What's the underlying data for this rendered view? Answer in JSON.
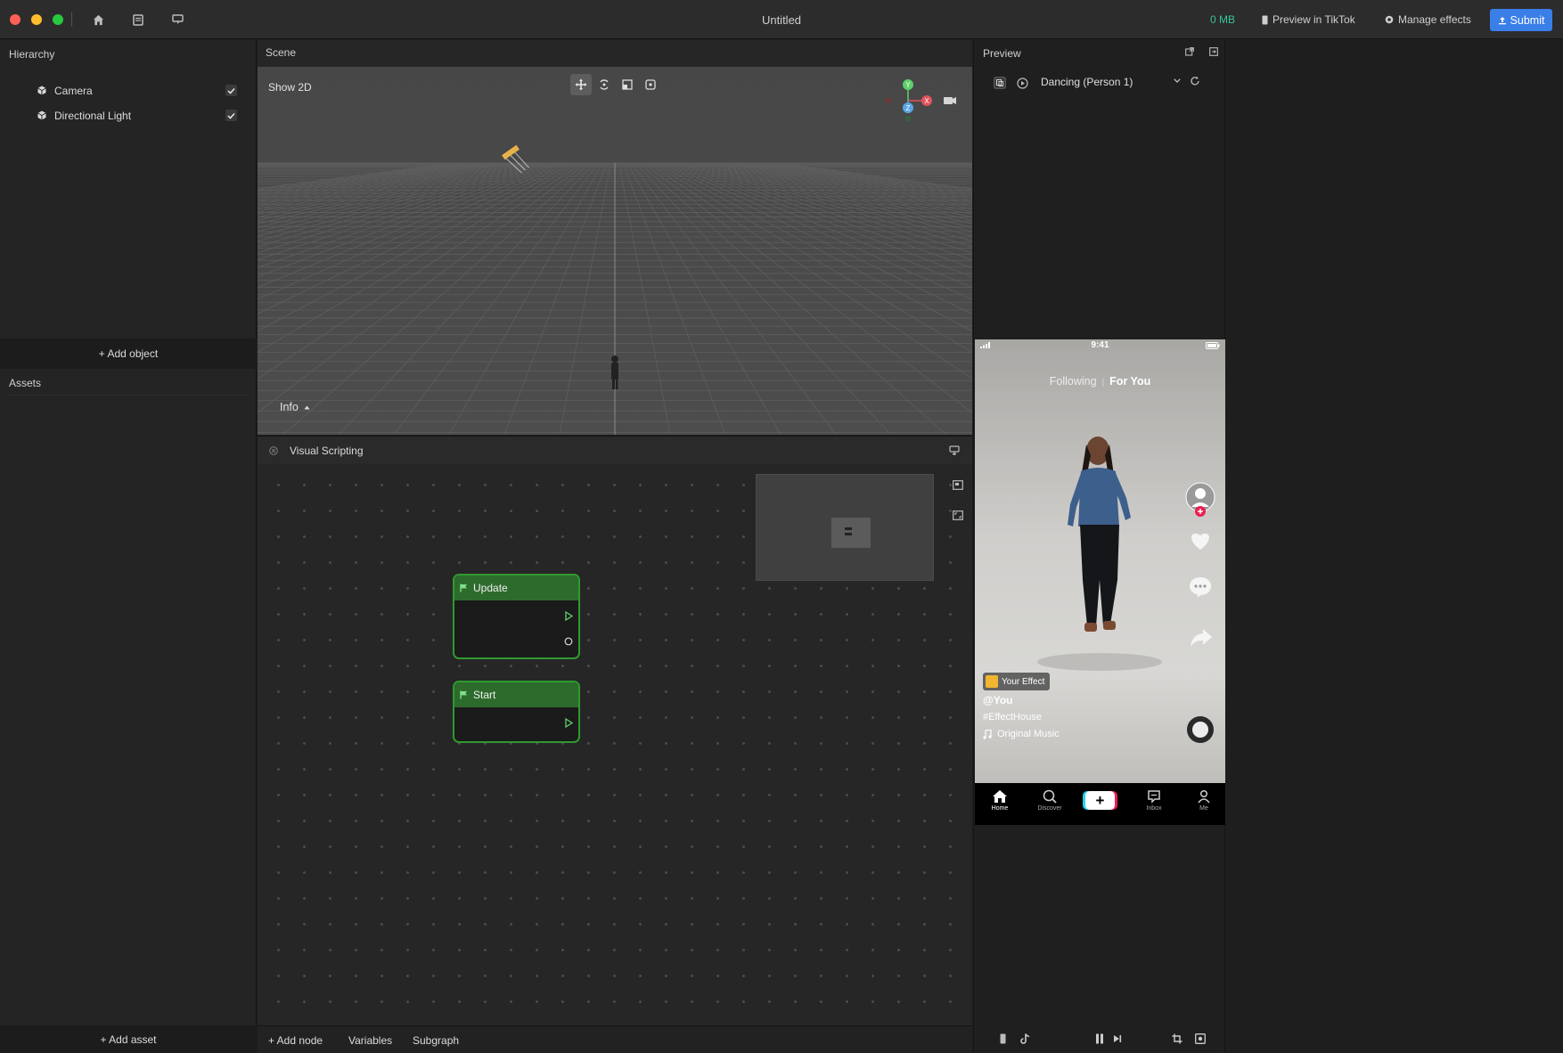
{
  "window": {
    "title": "Untitled",
    "memory": "0 MB",
    "preview_tiktok": "Preview in TikTok",
    "manage_effects": "Manage effects",
    "submit": "Submit"
  },
  "hierarchy": {
    "title": "Hierarchy",
    "items": [
      {
        "label": "Camera",
        "checked": true
      },
      {
        "label": "Directional Light",
        "checked": true
      }
    ],
    "add_object": "+ Add object"
  },
  "assets": {
    "title": "Assets",
    "add_asset": "+ Add asset"
  },
  "scene": {
    "title": "Scene",
    "show2d": "Show 2D",
    "info": "Info",
    "tools": [
      "move-icon",
      "rotate-icon",
      "scale-icon",
      "rect-icon"
    ],
    "axis_labels": {
      "y": "Y",
      "z": "Z",
      "x": "X"
    }
  },
  "visual_scripting": {
    "title": "Visual Scripting",
    "nodes": [
      {
        "title": "Update"
      },
      {
        "title": "Start"
      }
    ],
    "footer": {
      "add_node": "+ Add node",
      "variables": "Variables",
      "subgraph": "Subgraph"
    }
  },
  "preview": {
    "title": "Preview",
    "selected_video": "Dancing (Person 1)",
    "phone": {
      "time": "9:41",
      "tab_following": "Following",
      "tab_for_you": "For You",
      "effect_badge": "Your Effect",
      "username": "@You",
      "hashtag": "#EffectHouse",
      "music": "Original Music",
      "nav": [
        "Home",
        "Discover",
        "",
        "Inbox",
        "Me"
      ]
    }
  },
  "colors": {
    "accent": "#3a7ee8",
    "memory": "#36c39a",
    "node_border": "#2f9a2f",
    "node_header": "#2d6b2d"
  }
}
